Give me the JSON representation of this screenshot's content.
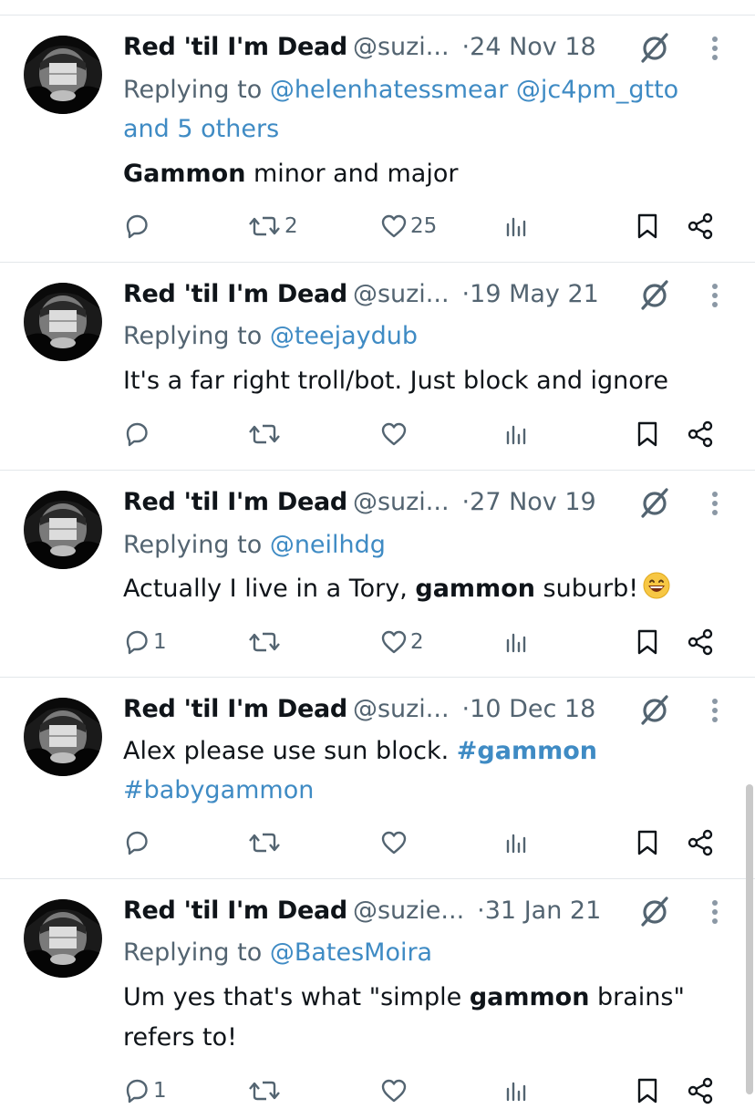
{
  "tweets": [
    {
      "name": "Red 'til I'm Dead",
      "handle": "@suzi...",
      "separator": "·",
      "date": "24 Nov 18",
      "reply_prefix": "Replying to",
      "reply_to": "@helenhatessmear @jc4pm_gtto",
      "reply_more": "and 5 others",
      "text_bold": "Gammon",
      "text_rest": " minor and major",
      "stats": {
        "replies": "",
        "retweets": "2",
        "likes": "25"
      }
    },
    {
      "name": "Red 'til I'm Dead",
      "handle": "@suzi...",
      "separator": "·",
      "date": "19 May 21",
      "reply_prefix": "Replying to",
      "reply_to": "@teejaydub",
      "text": "It's a far right troll/bot. Just block and ignore",
      "stats": {
        "replies": "",
        "retweets": "",
        "likes": ""
      }
    },
    {
      "name": "Red 'til I'm Dead",
      "handle": "@suzi...",
      "separator": "·",
      "date": "27 Nov 19",
      "reply_prefix": "Replying to",
      "reply_to": "@neilhdg",
      "text_before": "Actually I live in a Tory, ",
      "text_bold": "gammon",
      "text_after": " suburb!",
      "stats": {
        "replies": "1",
        "retweets": "",
        "likes": "2"
      }
    },
    {
      "name": "Red 'til I'm Dead",
      "handle": "@suzi...",
      "separator": "·",
      "date": "10 Dec 18",
      "text_before": "Alex please use sun block. ",
      "hashtag1": "#gammon",
      "hashtag2": "#babygammon",
      "stats": {
        "replies": "",
        "retweets": "",
        "likes": ""
      }
    },
    {
      "name": "Red 'til I'm Dead",
      "handle": "@suzie...",
      "separator": "·",
      "date": "31 Jan 21",
      "reply_prefix": "Replying to",
      "reply_to": "@BatesMoira",
      "text_before": "Um yes that's what \"simple ",
      "text_bold": "gammon",
      "text_after": " brains\"",
      "text_line2": "refers to!",
      "stats": {
        "replies": "1",
        "retweets": "",
        "likes": ""
      }
    }
  ],
  "icons": {
    "reply": "reply-icon",
    "retweet": "retweet-icon",
    "like": "heart-icon",
    "views": "views-icon",
    "bookmark": "bookmark-icon",
    "share": "share-icon",
    "grok": "slash-circle-icon",
    "more": "more-vertical-icon"
  },
  "colors": {
    "link": "#3f8bc4",
    "secondary": "#536471",
    "text": "#0f1419"
  }
}
